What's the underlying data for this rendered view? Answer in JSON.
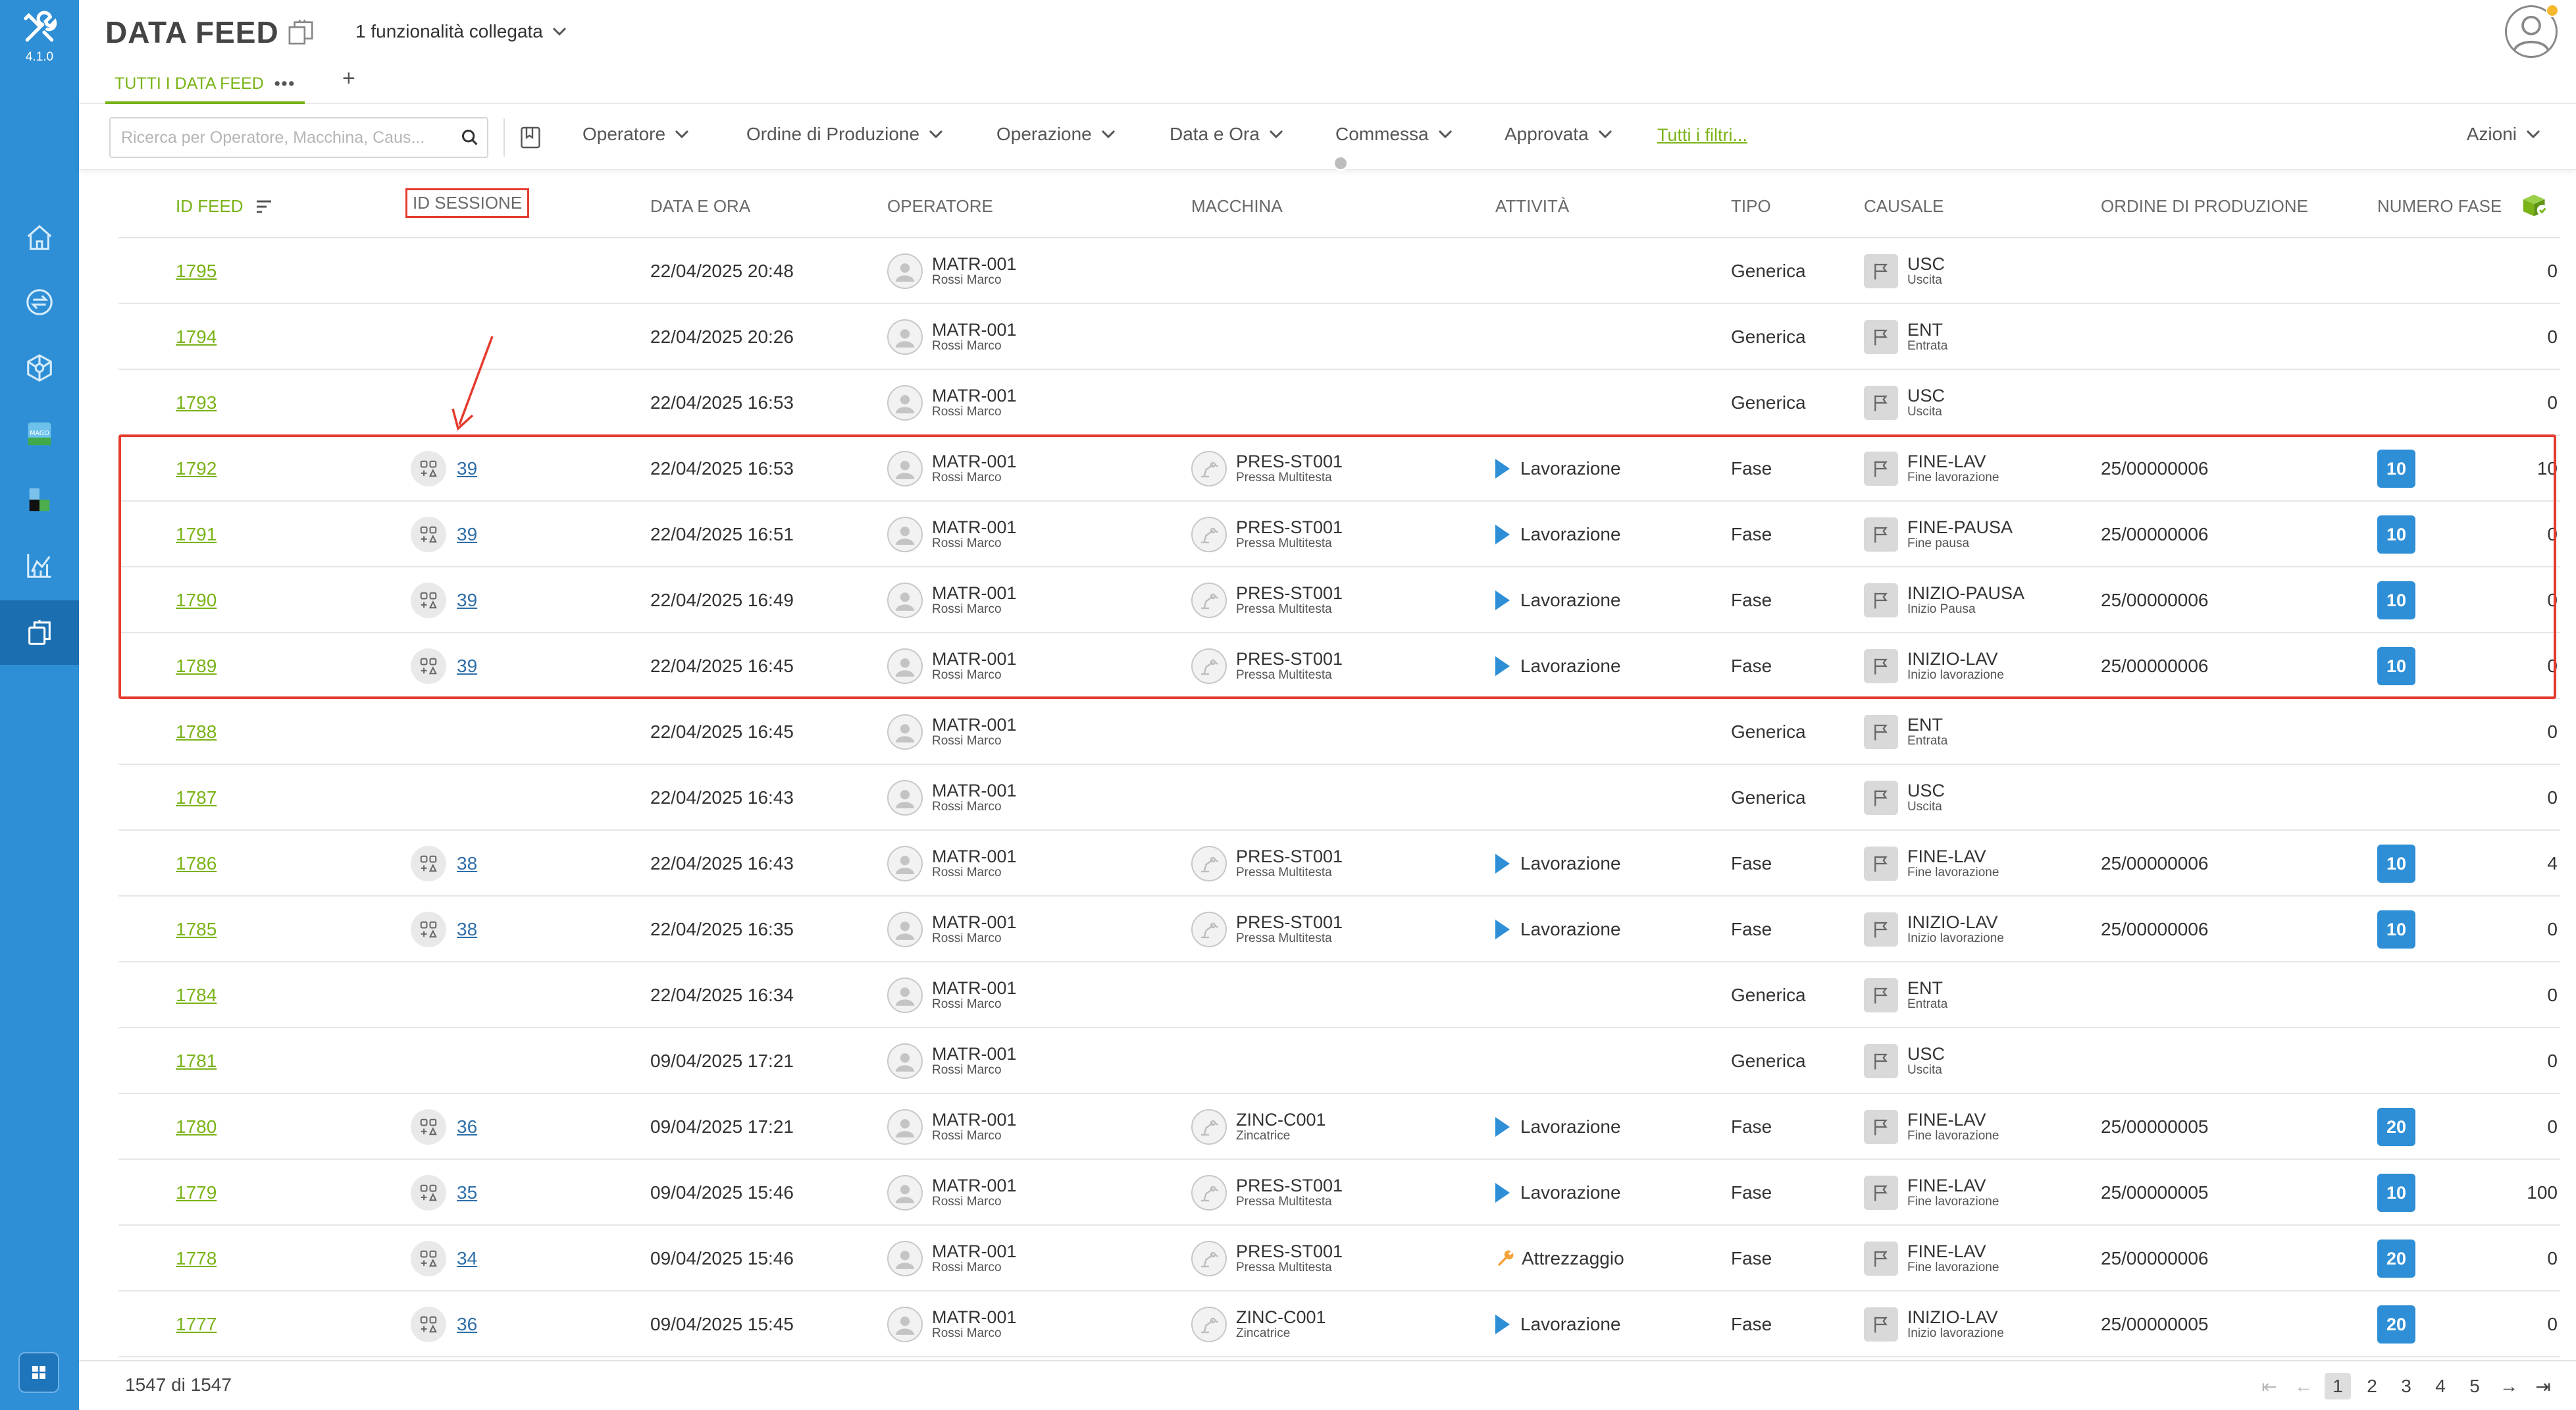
{
  "app": {
    "version": "4.1.0"
  },
  "header": {
    "title": "DATA FEED",
    "linked_features": "1 funzionalità collegata",
    "tab_label": "TUTTI I DATA FEED",
    "tab_menu": "•••",
    "add_tab": "+"
  },
  "filters": {
    "search_placeholder": "Ricerca per Operatore, Macchina, Caus...",
    "items": [
      "Operatore",
      "Ordine di Produzione",
      "Operazione",
      "Data e Ora",
      "Commessa",
      "Approvata"
    ],
    "all_filters": "Tutti i filtri...",
    "actions": "Azioni"
  },
  "table": {
    "columns": [
      "ID FEED",
      "ID SESSIONE",
      "DATA E ORA",
      "OPERATORE",
      "MACCHINA",
      "ATTIVITÀ",
      "TIPO",
      "CAUSALE",
      "ORDINE DI PRODUZIONE",
      "NUMERO FASE"
    ],
    "rows": [
      {
        "id": "1795",
        "session": "",
        "datetime": "22/04/2025 20:48",
        "op_code": "MATR-001",
        "op_name": "Rossi Marco",
        "machine": "",
        "machine_desc": "",
        "activity": "",
        "activity_icon": "",
        "type": "Generica",
        "reason": "USC",
        "reason_desc": "Uscita",
        "order": "",
        "phase": "",
        "qty": "0"
      },
      {
        "id": "1794",
        "session": "",
        "datetime": "22/04/2025 20:26",
        "op_code": "MATR-001",
        "op_name": "Rossi Marco",
        "machine": "",
        "machine_desc": "",
        "activity": "",
        "activity_icon": "",
        "type": "Generica",
        "reason": "ENT",
        "reason_desc": "Entrata",
        "order": "",
        "phase": "",
        "qty": "0"
      },
      {
        "id": "1793",
        "session": "",
        "datetime": "22/04/2025 16:53",
        "op_code": "MATR-001",
        "op_name": "Rossi Marco",
        "machine": "",
        "machine_desc": "",
        "activity": "",
        "activity_icon": "",
        "type": "Generica",
        "reason": "USC",
        "reason_desc": "Uscita",
        "order": "",
        "phase": "",
        "qty": "0"
      },
      {
        "id": "1792",
        "session": "39",
        "datetime": "22/04/2025 16:53",
        "op_code": "MATR-001",
        "op_name": "Rossi Marco",
        "machine": "PRES-ST001",
        "machine_desc": "Pressa Multitesta",
        "activity": "Lavorazione",
        "activity_icon": "play",
        "type": "Fase",
        "reason": "FINE-LAV",
        "reason_desc": "Fine lavorazione",
        "order": "25/00000006",
        "phase": "10",
        "qty": "10"
      },
      {
        "id": "1791",
        "session": "39",
        "datetime": "22/04/2025 16:51",
        "op_code": "MATR-001",
        "op_name": "Rossi Marco",
        "machine": "PRES-ST001",
        "machine_desc": "Pressa Multitesta",
        "activity": "Lavorazione",
        "activity_icon": "play",
        "type": "Fase",
        "reason": "FINE-PAUSA",
        "reason_desc": "Fine pausa",
        "order": "25/00000006",
        "phase": "10",
        "qty": "0"
      },
      {
        "id": "1790",
        "session": "39",
        "datetime": "22/04/2025 16:49",
        "op_code": "MATR-001",
        "op_name": "Rossi Marco",
        "machine": "PRES-ST001",
        "machine_desc": "Pressa Multitesta",
        "activity": "Lavorazione",
        "activity_icon": "play",
        "type": "Fase",
        "reason": "INIZIO-PAUSA",
        "reason_desc": "Inizio Pausa",
        "order": "25/00000006",
        "phase": "10",
        "qty": "0"
      },
      {
        "id": "1789",
        "session": "39",
        "datetime": "22/04/2025 16:45",
        "op_code": "MATR-001",
        "op_name": "Rossi Marco",
        "machine": "PRES-ST001",
        "machine_desc": "Pressa Multitesta",
        "activity": "Lavorazione",
        "activity_icon": "play",
        "type": "Fase",
        "reason": "INIZIO-LAV",
        "reason_desc": "Inizio lavorazione",
        "order": "25/00000006",
        "phase": "10",
        "qty": "0"
      },
      {
        "id": "1788",
        "session": "",
        "datetime": "22/04/2025 16:45",
        "op_code": "MATR-001",
        "op_name": "Rossi Marco",
        "machine": "",
        "machine_desc": "",
        "activity": "",
        "activity_icon": "",
        "type": "Generica",
        "reason": "ENT",
        "reason_desc": "Entrata",
        "order": "",
        "phase": "",
        "qty": "0"
      },
      {
        "id": "1787",
        "session": "",
        "datetime": "22/04/2025 16:43",
        "op_code": "MATR-001",
        "op_name": "Rossi Marco",
        "machine": "",
        "machine_desc": "",
        "activity": "",
        "activity_icon": "",
        "type": "Generica",
        "reason": "USC",
        "reason_desc": "Uscita",
        "order": "",
        "phase": "",
        "qty": "0"
      },
      {
        "id": "1786",
        "session": "38",
        "datetime": "22/04/2025 16:43",
        "op_code": "MATR-001",
        "op_name": "Rossi Marco",
        "machine": "PRES-ST001",
        "machine_desc": "Pressa Multitesta",
        "activity": "Lavorazione",
        "activity_icon": "play",
        "type": "Fase",
        "reason": "FINE-LAV",
        "reason_desc": "Fine lavorazione",
        "order": "25/00000006",
        "phase": "10",
        "qty": "4"
      },
      {
        "id": "1785",
        "session": "38",
        "datetime": "22/04/2025 16:35",
        "op_code": "MATR-001",
        "op_name": "Rossi Marco",
        "machine": "PRES-ST001",
        "machine_desc": "Pressa Multitesta",
        "activity": "Lavorazione",
        "activity_icon": "play",
        "type": "Fase",
        "reason": "INIZIO-LAV",
        "reason_desc": "Inizio lavorazione",
        "order": "25/00000006",
        "phase": "10",
        "qty": "0"
      },
      {
        "id": "1784",
        "session": "",
        "datetime": "22/04/2025 16:34",
        "op_code": "MATR-001",
        "op_name": "Rossi Marco",
        "machine": "",
        "machine_desc": "",
        "activity": "",
        "activity_icon": "",
        "type": "Generica",
        "reason": "ENT",
        "reason_desc": "Entrata",
        "order": "",
        "phase": "",
        "qty": "0"
      },
      {
        "id": "1781",
        "session": "",
        "datetime": "09/04/2025 17:21",
        "op_code": "MATR-001",
        "op_name": "Rossi Marco",
        "machine": "",
        "machine_desc": "",
        "activity": "",
        "activity_icon": "",
        "type": "Generica",
        "reason": "USC",
        "reason_desc": "Uscita",
        "order": "",
        "phase": "",
        "qty": "0"
      },
      {
        "id": "1780",
        "session": "36",
        "datetime": "09/04/2025 17:21",
        "op_code": "MATR-001",
        "op_name": "Rossi Marco",
        "machine": "ZINC-C001",
        "machine_desc": "Zincatrice",
        "activity": "Lavorazione",
        "activity_icon": "play",
        "type": "Fase",
        "reason": "FINE-LAV",
        "reason_desc": "Fine lavorazione",
        "order": "25/00000005",
        "phase": "20",
        "qty": "0"
      },
      {
        "id": "1779",
        "session": "35",
        "datetime": "09/04/2025 15:46",
        "op_code": "MATR-001",
        "op_name": "Rossi Marco",
        "machine": "PRES-ST001",
        "machine_desc": "Pressa Multitesta",
        "activity": "Lavorazione",
        "activity_icon": "play",
        "type": "Fase",
        "reason": "FINE-LAV",
        "reason_desc": "Fine lavorazione",
        "order": "25/00000005",
        "phase": "10",
        "qty": "100"
      },
      {
        "id": "1778",
        "session": "34",
        "datetime": "09/04/2025 15:46",
        "op_code": "MATR-001",
        "op_name": "Rossi Marco",
        "machine": "PRES-ST001",
        "machine_desc": "Pressa Multitesta",
        "activity": "Attrezzaggio",
        "activity_icon": "wrench",
        "type": "Fase",
        "reason": "FINE-LAV",
        "reason_desc": "Fine lavorazione",
        "order": "25/00000006",
        "phase": "20",
        "qty": "0"
      },
      {
        "id": "1777",
        "session": "36",
        "datetime": "09/04/2025 15:45",
        "op_code": "MATR-001",
        "op_name": "Rossi Marco",
        "machine": "ZINC-C001",
        "machine_desc": "Zincatrice",
        "activity": "Lavorazione",
        "activity_icon": "play",
        "type": "Fase",
        "reason": "INIZIO-LAV",
        "reason_desc": "Inizio lavorazione",
        "order": "25/00000005",
        "phase": "20",
        "qty": "0"
      }
    ]
  },
  "footer": {
    "count": "1547 di 1547",
    "pages": [
      "1",
      "2",
      "3",
      "4",
      "5"
    ],
    "current_page": "1"
  },
  "colors": {
    "sidebar": "#2e8fd6",
    "accent_green": "#7ab317",
    "highlight_red": "#e53b2f",
    "badge_blue": "#2e8fd6"
  }
}
